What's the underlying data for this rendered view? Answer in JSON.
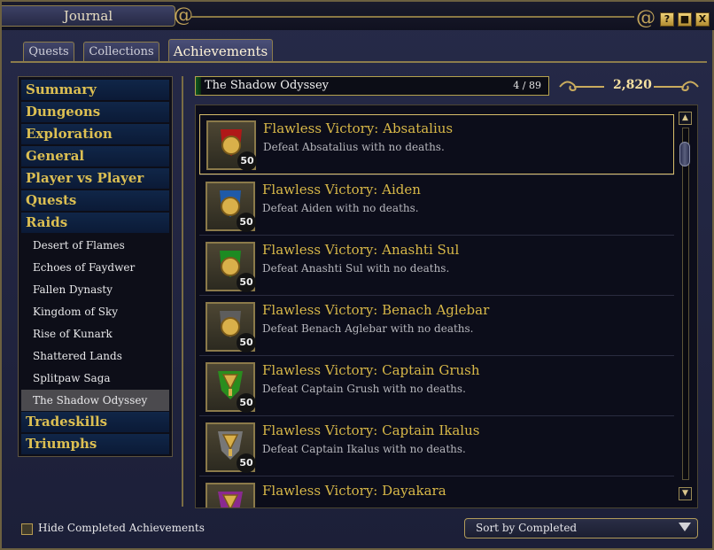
{
  "window": {
    "title": "Journal",
    "help_label": "?",
    "min_label": "■",
    "close_label": "X"
  },
  "tabs": [
    {
      "label": "Quests"
    },
    {
      "label": "Collections"
    },
    {
      "label": "Achievements"
    }
  ],
  "sidebar": {
    "categories": [
      {
        "label": "Summary"
      },
      {
        "label": "Dungeons"
      },
      {
        "label": "Exploration"
      },
      {
        "label": "General"
      },
      {
        "label": "Player vs Player"
      },
      {
        "label": "Quests"
      },
      {
        "label": "Raids"
      }
    ],
    "raids": [
      {
        "label": "Desert of Flames"
      },
      {
        "label": "Echoes of Faydwer"
      },
      {
        "label": "Fallen Dynasty"
      },
      {
        "label": "Kingdom of Sky"
      },
      {
        "label": "Rise of Kunark"
      },
      {
        "label": "Shattered Lands"
      },
      {
        "label": "Splitpaw Saga"
      },
      {
        "label": "The Shadow Odyssey"
      }
    ],
    "bottom_categories": [
      {
        "label": "Tradeskills"
      },
      {
        "label": "Triumphs"
      }
    ]
  },
  "header": {
    "title": "The Shadow Odyssey",
    "count": "4 / 89",
    "points": "2,820"
  },
  "achievements": [
    {
      "title": "Flawless Victory: Absatalius",
      "desc": "Defeat Absatalius with no deaths.",
      "points": "50",
      "icon": "red-medal-icon",
      "color": "#b01818"
    },
    {
      "title": "Flawless Victory: Aiden",
      "desc": "Defeat Aiden with no deaths.",
      "points": "50",
      "icon": "blue-medal-icon",
      "color": "#1f5aa8"
    },
    {
      "title": "Flawless Victory: Anashti Sul",
      "desc": "Defeat Anashti Sul with no deaths.",
      "points": "50",
      "icon": "green-medal-icon",
      "color": "#1c8a22"
    },
    {
      "title": "Flawless Victory: Benach Aglebar",
      "desc": "Defeat Benach Aglebar with no deaths.",
      "points": "50",
      "icon": "grey-medal-icon",
      "color": "#5d5d5d"
    },
    {
      "title": "Flawless Victory: Captain Grush",
      "desc": "Defeat Captain Grush with no deaths.",
      "points": "50",
      "icon": "green-trophy-icon",
      "color": "#2a8d1e"
    },
    {
      "title": "Flawless Victory: Captain Ikalus",
      "desc": "Defeat Captain Ikalus with no deaths.",
      "points": "50",
      "icon": "grey-trophy-icon",
      "color": "#777777"
    },
    {
      "title": "Flawless Victory: Dayakara",
      "desc": "",
      "points": "",
      "icon": "purple-trophy-icon",
      "color": "#8a2a90"
    }
  ],
  "footer": {
    "hide_completed_label": "Hide Completed Achievements",
    "sort_label": "Sort by Completed"
  },
  "scrollbar": {
    "up_icon": "▲",
    "down_icon": "▼"
  }
}
